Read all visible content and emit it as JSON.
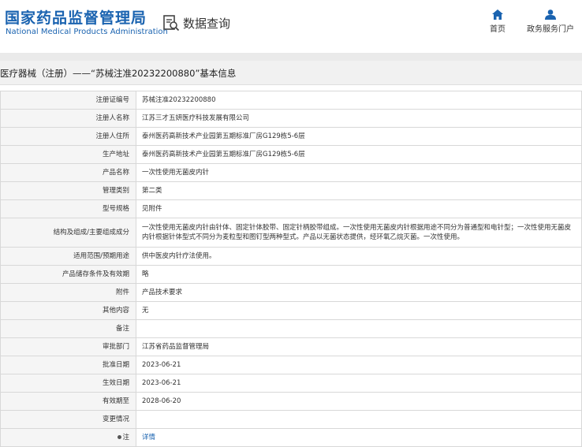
{
  "header": {
    "logo_cn": "国家药品监督管理局",
    "logo_en": "National Medical Products Administration",
    "query_label": "数据查询",
    "query_icon": "search-document-icon",
    "nav": [
      {
        "label": "首页",
        "icon": "home-icon"
      },
      {
        "label": "政务服务门户",
        "icon": "user-icon"
      }
    ],
    "brand_color": "#1a63b0"
  },
  "page_title": "医疗器械（注册）——“苏械注准20232200880”基本信息",
  "rows": [
    {
      "label": "注册证编号",
      "value": "苏械注准20232200880"
    },
    {
      "label": "注册人名称",
      "value": "江苏三才五妍医疗科技发展有限公司"
    },
    {
      "label": "注册人住所",
      "value": "泰州医药高新技术产业园第五期标准厂房G129栋5-6层"
    },
    {
      "label": "生产地址",
      "value": "泰州医药高新技术产业园第五期标准厂房G129栋5-6层"
    },
    {
      "label": "产品名称",
      "value": "一次性使用无菌皮内针"
    },
    {
      "label": "管理类别",
      "value": "第二类"
    },
    {
      "label": "型号规格",
      "value": "见附件"
    },
    {
      "label": "结构及组成/主要组成成分",
      "value": "一次性使用无菌皮内针由针体、固定针体胶带、固定针柄胶带组成。一次性使用无菌皮内针根据用途不同分为普通型和电针型；一次性使用无菌皮内针根据针体型式不同分为麦粒型和图钉型两种型式。产品以无菌状态提供，经环氧乙烷灭菌。一次性使用。"
    },
    {
      "label": "适用范围/预期用途",
      "value": "供中医皮内针疗法使用。"
    },
    {
      "label": "产品储存条件及有效期",
      "value": "略"
    },
    {
      "label": "附件",
      "value": "产品技术要求"
    },
    {
      "label": "其他内容",
      "value": "无"
    },
    {
      "label": "备注",
      "value": ""
    },
    {
      "label": "审批部门",
      "value": "江苏省药品监督管理局"
    },
    {
      "label": "批准日期",
      "value": "2023-06-21"
    },
    {
      "label": "生效日期",
      "value": "2023-06-21"
    },
    {
      "label": "有效期至",
      "value": "2028-06-20"
    },
    {
      "label": "变更情况",
      "value": ""
    }
  ],
  "note_row": {
    "label": "注",
    "link": "详情",
    "icon": "bullet-dot-icon"
  }
}
